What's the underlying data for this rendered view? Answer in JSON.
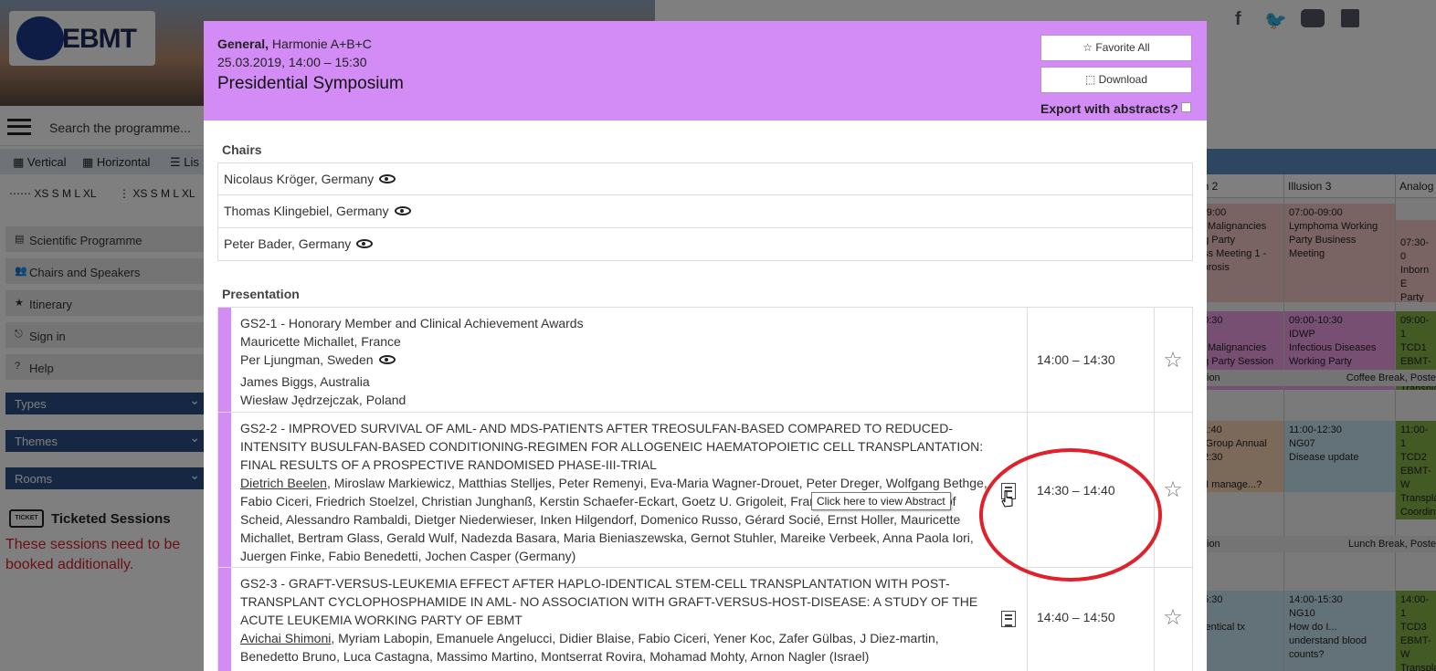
{
  "background": {
    "logo_text": "EBMT",
    "search_placeholder": "Search the programme...",
    "view_modes": [
      "Vertical",
      "Horizontal",
      "Lis"
    ],
    "size_labels": [
      "XS S M L XL",
      "XS S M L XL"
    ],
    "menu": [
      "Scientific Programme",
      "Chairs and Speakers",
      "Itinerary",
      "Sign in",
      "Help"
    ],
    "filters": [
      "Types",
      "Themes",
      "Rooms"
    ],
    "ticket_badge": "TICKET",
    "ticket_title": "Ticketed Sessions",
    "ticket_note": "These sessions need to be booked additionally.",
    "grid": {
      "columns": [
        "on 2",
        "Illusion 3",
        "Analog"
      ],
      "col1": [
        "-09:00\nic Malignancies\nng Party\ness Meeting 1 -\nfibrosis",
        "10:30\n\nic Malignancies\nng Party Session",
        "11:40\ns Group Annual\n12:30\n\no I manage...?",
        "15:30\n\nidentical tx"
      ],
      "col2": [
        "07:00-09:00\nLymphoma Working\nParty Business\nMeeting",
        "09:00-10:30\nIDWP\nInfectious Diseases\nWorking Party Session",
        "11:00-12:30\nNG07\nDisease update",
        "14:00-15:30\nNG10\nHow do I...\nunderstand blood\ncounts?"
      ],
      "col3": [
        "\n07:30-0\nInborn E\nParty B\nMeeting",
        "09:00-1\nTCD1\nEBMT-W\nTranspla\nCoordin\nIdentifi",
        "11:00-1\nTCD2\nEBMT-W\nTranspla\nCoordin\nStem ce",
        "14:00-1\nTCD3\nEBMT-W\nTranspla\nCoordin"
      ],
      "bands": [
        {
          "left": "ion",
          "right": "Coffee Break, Poste"
        },
        {
          "left": "ion",
          "right": "Lunch Break, Poste"
        }
      ]
    }
  },
  "modal": {
    "header": {
      "category": "General,",
      "room": "Harmonie A+B+C",
      "datetime": "25.03.2019, 14:00 – 15:30",
      "title": "Presidential Symposium",
      "favorite_all": "☆ Favorite All",
      "download": "⬚ Download",
      "export_label": "Export with abstracts?"
    },
    "chairs_heading": "Chairs",
    "chairs": [
      "Nicolaus Kröger, Germany",
      "Thomas Klingebiel, Germany",
      "Peter Bader, Germany"
    ],
    "presentation_heading": "Presentation",
    "presentations": [
      {
        "title": "GS2-1 - Honorary Member and Clinical Achievement Awards",
        "people": [
          "Mauricette Michallet, France",
          "Per Ljungman, Sweden",
          "James Biggs, Australia",
          "Wiesław Jędrzejczak, Poland"
        ],
        "time": "14:00 – 14:30"
      },
      {
        "title": "GS2-2 - IMPROVED SURVIVAL OF AML- AND MDS-PATIENTS AFTER TREOSULFAN-BASED COMPARED TO REDUCED-INTENSITY BUSULFAN-BASED CONDITIONING-REGIMEN FOR ALLOGENEIC HAEMATOPOIETIC CELL TRANSPLANTATION: FINAL RESULTS OF A PROSPECTIVE RANDOMISED PHASE-III-TRIAL",
        "presenter": "Dietrich Beelen",
        "authors": ", Miroslaw Markiewicz, Matthias Stelljes, Peter Remenyi, Eva-Maria Wagner-Drouet, Peter Dreger, Wolfgang Bethge, Fabio Ciceri, Friedrich Stoelzel, Christian Junghanß, Kerstin Schaefer-Eckart, Goetz U. Grigoleit, Francesca Patriarca, Christof Scheid, Alessandro Rambaldi, Dietger Niederwieser, Inken Hilgendorf, Domenico Russo, Gérard Socié, Ernst Holler, Mauricette Michallet, Bertram Glass, Gerald Wulf, Nadezda Basara, Maria Bieniaszewska, Gernot Stuhler, Mareike Verbeek, Anna Paola Iori, Juergen Finke, Fabio Benedetti, Jochen Casper (Germany)",
        "time": "14:30 – 14:40"
      },
      {
        "title": "GS2-3 - GRAFT-VERSUS-LEUKEMIA EFFECT AFTER HAPLO-IDENTICAL STEM-CELL TRANSPLANTATION WITH POST-TRANSPLANT CYCLOPHOSPHAMIDE IN AML- NO ASSOCIATION WITH GRAFT-VERSUS-HOST-DISEASE: A STUDY OF THE ACUTE LEUKEMIA WORKING PARTY OF EBMT",
        "presenter": "Avichai Shimoni",
        "authors": ", Myriam Labopin, Emanuele Angelucci, Didier Blaise, Fabio Ciceri, Yener Koc, Zafer Gülbas, J Diez-martin, Benedetto Bruno, Luca Castagna, Massimo Martino, Montserrat Rovira, Mohamad Mohty, Arnon Nagler (Israel)",
        "time": "14:40 – 14:50"
      }
    ],
    "tooltip": "Click here to view Abstract"
  },
  "colors": {
    "session_accent": "#d38cf5",
    "annotation_ring": "#e0202a",
    "ticket_note": "#d81f2b"
  }
}
